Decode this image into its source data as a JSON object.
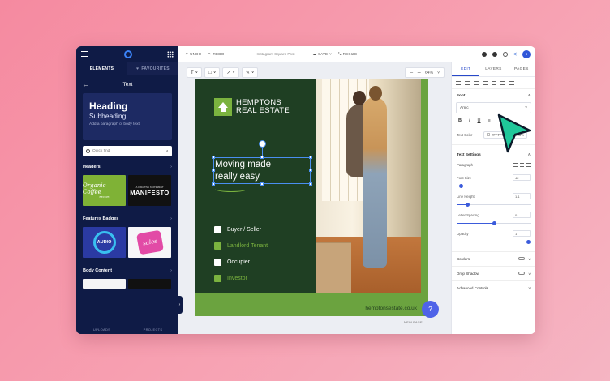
{
  "sidebar": {
    "tabs": [
      {
        "label": "ELEMENTS"
      },
      {
        "label": "FAVOURITES"
      }
    ],
    "section_title": "Text",
    "text_card": {
      "heading": "Heading",
      "subheading": "Subheading",
      "body": "Add a paragraph of body text"
    },
    "search": {
      "placeholder": "Quick find"
    },
    "sections": {
      "headers": "Headers",
      "features_badges": "Features Badges",
      "body_content": "Body Content"
    },
    "thumbs": {
      "organic_coffee": "Organic Coffee",
      "organic_sub": "RECIPE",
      "manifesto": "MANIFESTO",
      "manifesto_sub": "A CREATIVE STATEMENT",
      "audio": "AUDIO",
      "sales": "sales"
    },
    "footer": {
      "uploads": "UPLOADS",
      "projects": "PROJECTS"
    }
  },
  "toolbar": {
    "undo": "UNDO",
    "redo": "REDO",
    "doc_title": "Instagram Square Post",
    "save": "SAVE",
    "resize": "RESIZE"
  },
  "canvas": {
    "zoom": "64%",
    "new_page": "NEW PAGE",
    "help": "?"
  },
  "design": {
    "brand_line1": "HEMPTONS",
    "brand_line2": "REAL ESTATE",
    "headline_line1": "Moving made",
    "headline_line2": "really easy",
    "audience": [
      {
        "label": "Buyer / Seller",
        "color": "#ffffff"
      },
      {
        "label": "Landlord Tenant",
        "color": "#7bb33f"
      },
      {
        "label": "Occupier",
        "color": "#ffffff"
      },
      {
        "label": "Investor",
        "color": "#7bb33f"
      }
    ],
    "website": "hemptonsestate.co.uk"
  },
  "panel": {
    "tabs": [
      {
        "label": "EDIT"
      },
      {
        "label": "LAYERS"
      },
      {
        "label": "PAGES"
      }
    ],
    "font_section": "Font",
    "font_value": "Amic",
    "text_color_label": "Text Color",
    "text_color_value": "#FFFFFF",
    "text_opacity": "100%",
    "text_settings": "Text Settings",
    "paragraph_label": "Paragraph",
    "font_size_label": "Font Size",
    "font_size_value": "42",
    "line_height_label": "Line Height",
    "line_height_value": "1.1",
    "letter_spacing_label": "Letter Spacing",
    "letter_spacing_value": "0",
    "opacity_label": "Opacity",
    "opacity_value": "1",
    "borders": "Borders",
    "drop_shadow": "Drop Shadow",
    "advanced": "Advanced Controls"
  },
  "colors": {
    "sidebar_bg": "#0f1b46",
    "accent": "#2748c9",
    "brand_green": "#7bb33f",
    "design_dark": "#1f3f23",
    "cursor": "#1fc79a"
  }
}
